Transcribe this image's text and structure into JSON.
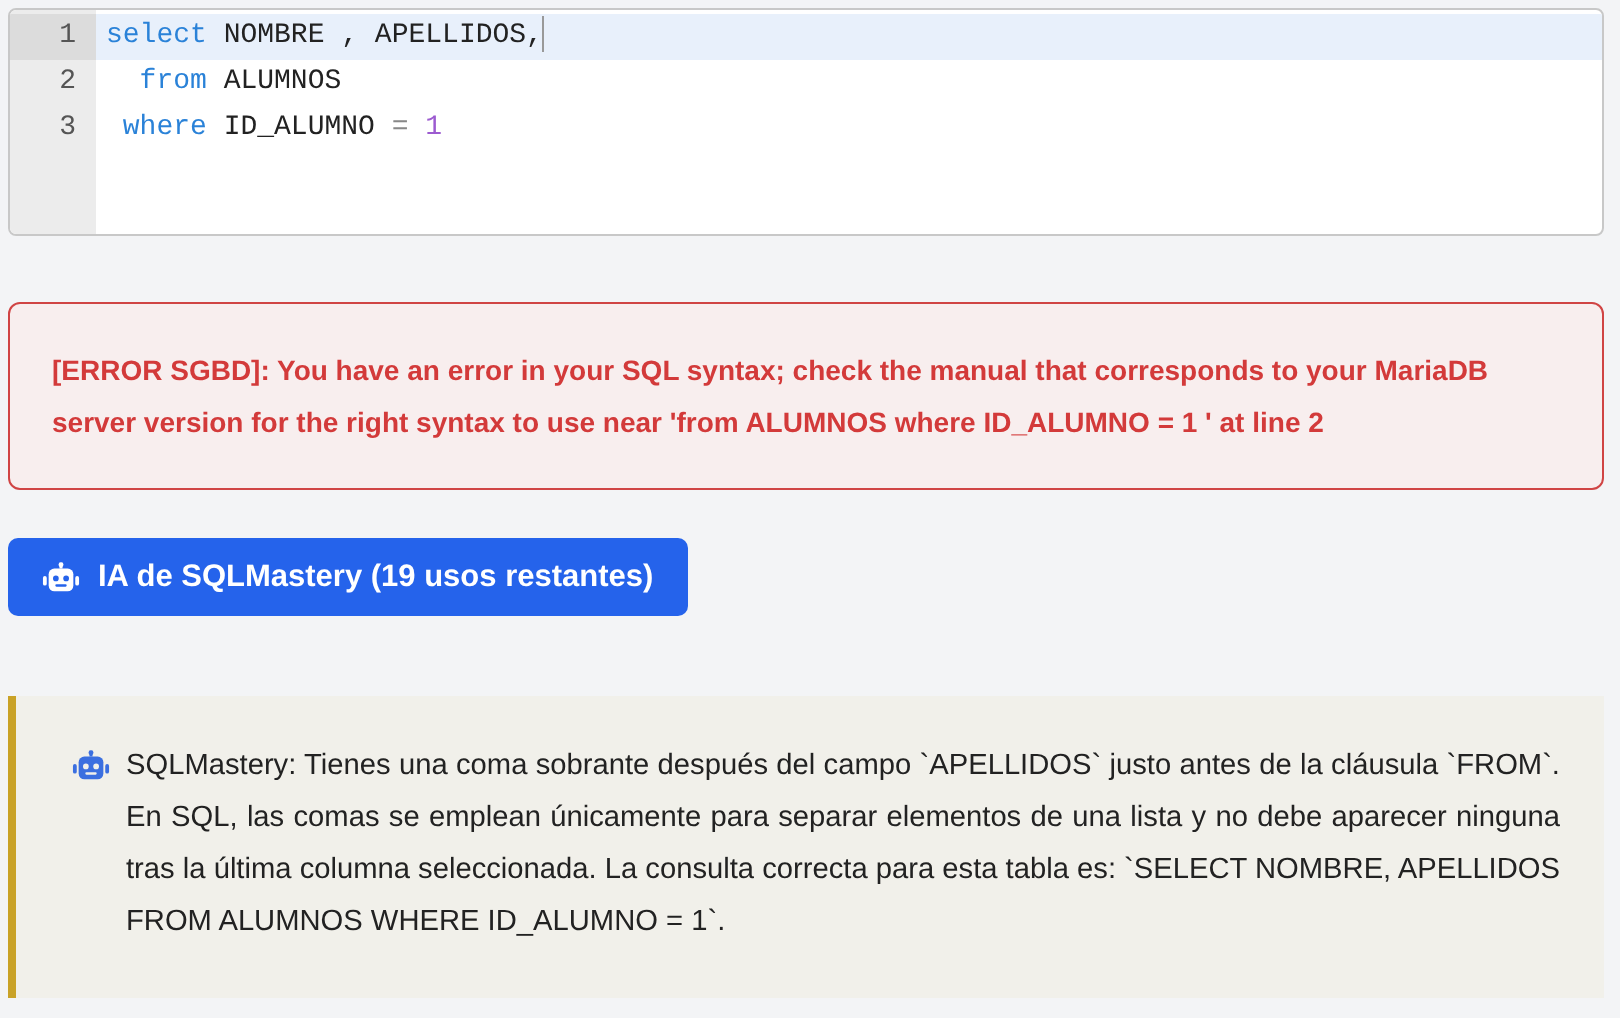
{
  "editor": {
    "lines": [
      {
        "number": "1",
        "active": true,
        "tokens": [
          {
            "kind": "keyword",
            "text": "select"
          },
          {
            "kind": "plain",
            "text": " NOMBRE , APELLIDOS,"
          }
        ]
      },
      {
        "number": "2",
        "active": false,
        "tokens": [
          {
            "kind": "keyword",
            "text": "  from"
          },
          {
            "kind": "plain",
            "text": " ALUMNOS"
          }
        ]
      },
      {
        "number": "3",
        "active": false,
        "tokens": [
          {
            "kind": "keyword",
            "text": " where"
          },
          {
            "kind": "plain",
            "text": " ID_ALUMNO "
          },
          {
            "kind": "operator",
            "text": "="
          },
          {
            "kind": "number",
            "text": " 1"
          }
        ]
      }
    ]
  },
  "error": {
    "message": "[ERROR SGBD]: You have an error in your SQL syntax; check the manual that corresponds to your MariaDB server version for the right syntax to use near 'from ALUMNOS where ID_ALUMNO = 1 ' at line 2"
  },
  "ai_button": {
    "label": "IA de SQLMastery (19 usos restantes)"
  },
  "hint": {
    "text": "SQLMastery: Tienes una coma sobrante después del campo `APELLIDOS` justo antes de la cláusula `FROM`. En SQL, las comas se emplean únicamente para separar elementos de una lista y no debe aparecer ninguna tras la última columna seleccionada. La consulta correcta para esta tabla es: `SELECT NOMBRE, APELLIDOS FROM ALUMNOS WHERE ID_ALUMNO = 1`."
  }
}
